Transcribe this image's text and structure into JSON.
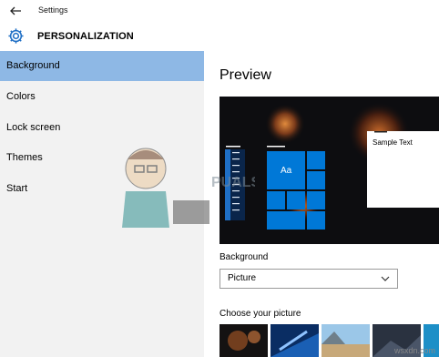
{
  "window": {
    "title": "Settings"
  },
  "header": {
    "section_title": "PERSONALIZATION"
  },
  "sidebar": {
    "items": [
      {
        "label": "Background",
        "selected": true
      },
      {
        "label": "Colors",
        "selected": false
      },
      {
        "label": "Lock screen",
        "selected": false
      },
      {
        "label": "Themes",
        "selected": false
      },
      {
        "label": "Start",
        "selected": false
      }
    ]
  },
  "preview": {
    "title": "Preview",
    "tile_label": "Aa",
    "sample_text": "Sample Text"
  },
  "background": {
    "label": "Background",
    "value": "Picture"
  },
  "choose": {
    "label": "Choose your picture"
  },
  "watermark": {
    "text": "wsxdn.com"
  },
  "colors": {
    "accent": "#0078d7",
    "selected_nav": "#8eb8e5",
    "sidebar_bg": "#f2f2f2"
  }
}
